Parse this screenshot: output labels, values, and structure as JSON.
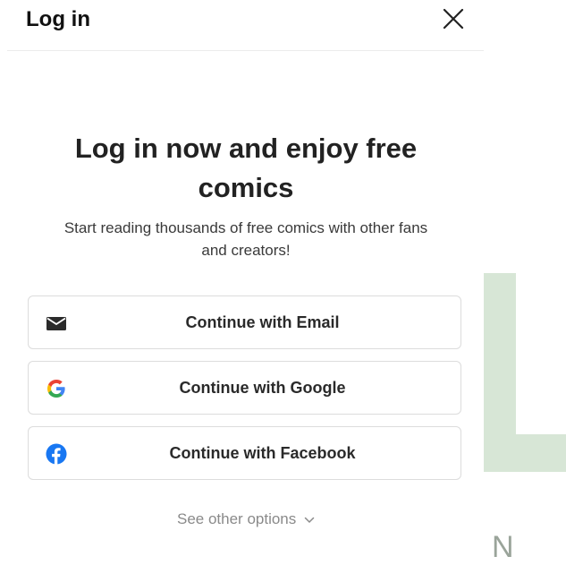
{
  "header": {
    "title": "Log in",
    "close_icon": "close-icon"
  },
  "hero": {
    "title": "Log in now and enjoy free comics",
    "subtitle": "Start reading thousands of free comics with other fans and creators!"
  },
  "auth_options": [
    {
      "label": "Continue with Email",
      "icon": "email-icon"
    },
    {
      "label": "Continue with Google",
      "icon": "google-icon"
    },
    {
      "label": "Continue with Facebook",
      "icon": "facebook-icon"
    }
  ],
  "footer": {
    "other_options_label": "See other options",
    "chevron_icon": "chevron-down-icon"
  },
  "background": {
    "letter": "N"
  },
  "colors": {
    "facebook_blue": "#1877f2",
    "google_blue": "#4285f4",
    "google_red": "#ea4335",
    "google_yellow": "#fbbc05",
    "google_green": "#34a853",
    "backdrop_green": "#d7e6d6"
  }
}
